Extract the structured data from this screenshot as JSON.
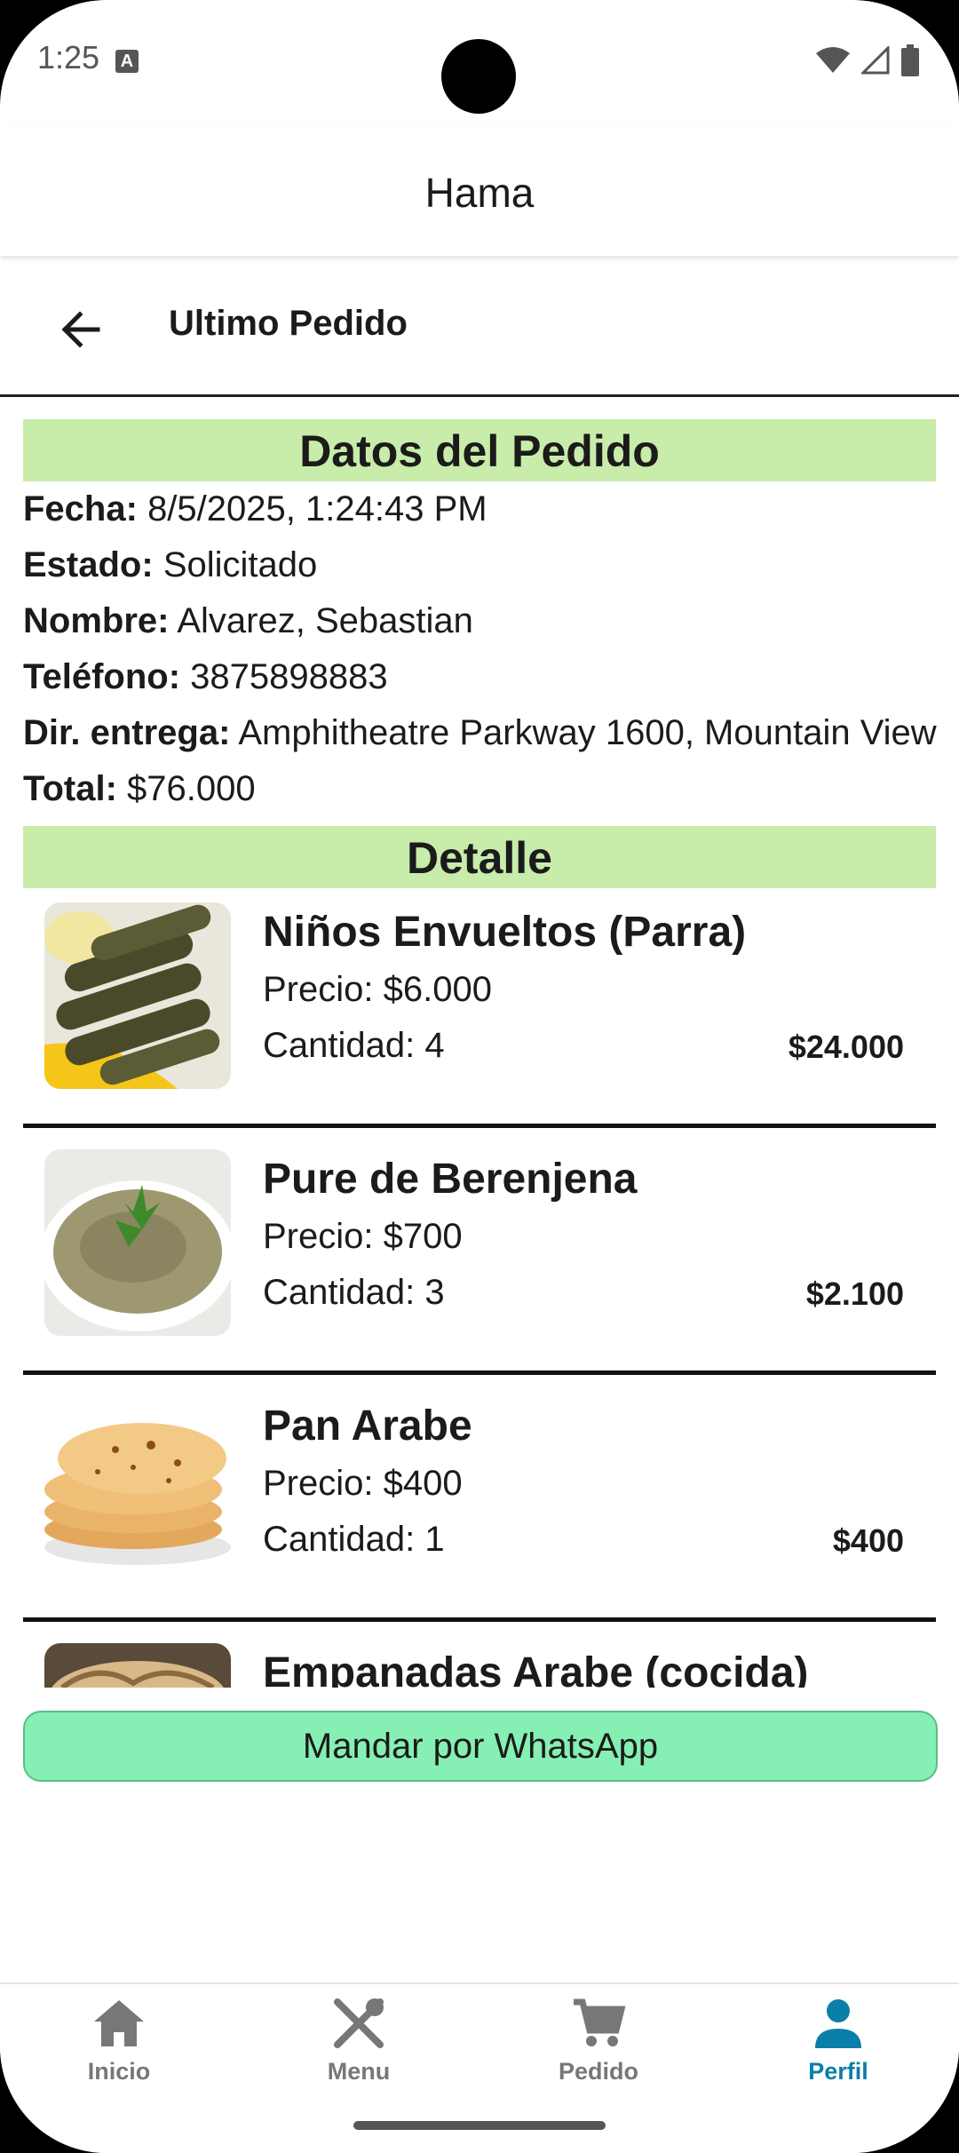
{
  "status": {
    "time": "1:25",
    "notif_icon": "A"
  },
  "app": {
    "title": "Hama"
  },
  "page": {
    "title": "Ultimo Pedido"
  },
  "order": {
    "section_title": "Datos del Pedido",
    "fields": [
      {
        "label": "Fecha:",
        "value": "8/5/2025, 1:24:43 PM"
      },
      {
        "label": "Estado:",
        "value": "Solicitado"
      },
      {
        "label": "Nombre:",
        "value": "Alvarez, Sebastian"
      },
      {
        "label": "Teléfono:",
        "value": "3875898883"
      },
      {
        "label": "Dir. entrega:",
        "value": "Amphitheatre Parkway 1600, Mountain View"
      },
      {
        "label": "Total:",
        "value": "$76.000"
      }
    ]
  },
  "detail": {
    "section_title": "Detalle",
    "items": [
      {
        "name": "Niños Envueltos (Parra)",
        "price": "Precio: $6.000",
        "qty": "Cantidad: 4",
        "subtotal": "$24.000",
        "image": "stuffed-grape-leaves"
      },
      {
        "name": "Pure de Berenjena",
        "price": "Precio: $700",
        "qty": "Cantidad: 3",
        "subtotal": "$2.100",
        "image": "eggplant-puree"
      },
      {
        "name": "Pan Arabe",
        "price": "Precio: $400",
        "qty": "Cantidad: 1",
        "subtotal": "$400",
        "image": "pita-bread"
      },
      {
        "name": "Empanadas Arabe (cocida)",
        "price": "",
        "qty": "",
        "subtotal": "",
        "image": "empanadas"
      }
    ]
  },
  "actions": {
    "whatsapp_label": "Mandar por WhatsApp"
  },
  "nav": {
    "items": [
      {
        "label": "Inicio",
        "icon": "home-icon"
      },
      {
        "label": "Menu",
        "icon": "utensils-icon"
      },
      {
        "label": "Pedido",
        "icon": "cart-icon"
      },
      {
        "label": "Perfil",
        "icon": "person-icon",
        "active": true
      }
    ],
    "active_color": "#0a7fa8"
  },
  "colors": {
    "section_band": "#c8ecaa",
    "whatsapp_button": "#86efb3"
  }
}
